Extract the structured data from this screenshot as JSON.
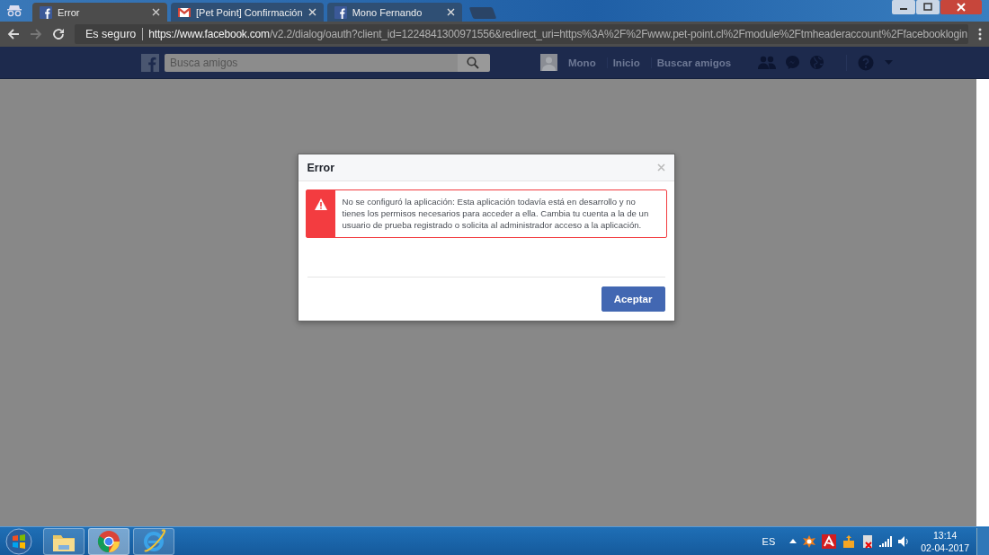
{
  "browser": {
    "tabs": [
      {
        "title": "Error",
        "kind": "facebook",
        "selected": true
      },
      {
        "title": "[Pet Point] Confirmación",
        "kind": "mail",
        "selected": false
      },
      {
        "title": "Mono Fernando",
        "kind": "facebook",
        "selected": false
      }
    ],
    "security_label": "Es seguro",
    "url_host": "https://www.facebook.com",
    "url_path": "/v2.2/dialog/oauth?client_id=1224841300971556&redirect_uri=https%3A%2F%2Fwww.pet-point.cl%2Fmodule%2Ftmheaderaccount%2Ffacebooklogin"
  },
  "facebook_header": {
    "search": {
      "placeholder": "Busca amigos"
    },
    "profile_name": "Mono",
    "nav_links": [
      "Inicio",
      "Buscar amigos"
    ]
  },
  "dialog": {
    "title": "Error",
    "message": "No se configuró la aplicación: Esta aplicación todavía está en desarrollo y no tienes los permisos necesarios para acceder a ella. Cambia tu cuenta a la de un usuario de prueba registrado o solicita al administrador acceso a la aplicación.",
    "button": "Aceptar"
  },
  "taskbar": {
    "apps": [
      {
        "kind": "explorer",
        "active": false
      },
      {
        "kind": "chrome",
        "active": true
      },
      {
        "kind": "ie",
        "active": false
      }
    ],
    "language": "ES",
    "time": "13:14",
    "date": "02-04-2017"
  }
}
